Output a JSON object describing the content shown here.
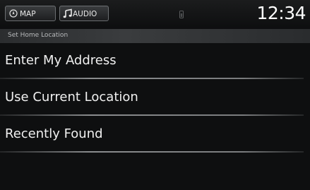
{
  "status_bar": {
    "map_label": "MAP",
    "audio_label": "AUDIO",
    "clock": "12:34"
  },
  "title_bar": {
    "title": "Set Home Location"
  },
  "menu": {
    "items": [
      {
        "label": "Enter My Address"
      },
      {
        "label": "Use Current Location"
      },
      {
        "label": "Recently Found"
      }
    ]
  },
  "colors": {
    "background": "#0e0f10",
    "text": "#f0f0f0",
    "button_border": "#6b6e71",
    "divider": "#8a8c8e"
  },
  "icons": {
    "map": "compass-icon",
    "audio": "music-note-icon",
    "status": "signal-indicator-icon"
  }
}
